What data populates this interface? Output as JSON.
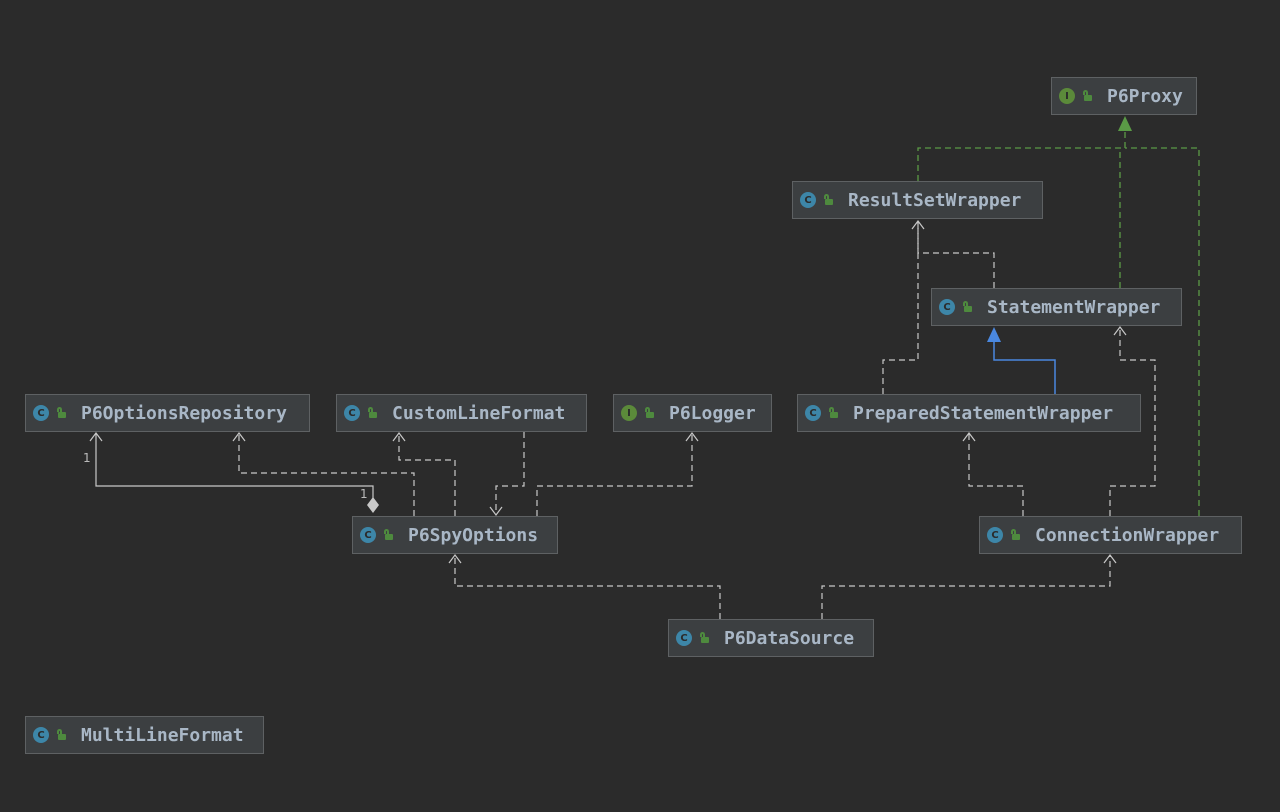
{
  "nodes": [
    {
      "id": "p6proxy",
      "label": "P6Proxy",
      "kind": "interface",
      "badge": "I"
    },
    {
      "id": "resultsetwrapper",
      "label": "ResultSetWrapper",
      "kind": "class",
      "badge": "C"
    },
    {
      "id": "statementwrapper",
      "label": "StatementWrapper",
      "kind": "class",
      "badge": "C"
    },
    {
      "id": "p6optionsrepository",
      "label": "P6OptionsRepository",
      "kind": "class",
      "badge": "C"
    },
    {
      "id": "customlineformat",
      "label": "CustomLineFormat",
      "kind": "class",
      "badge": "C"
    },
    {
      "id": "p6logger",
      "label": "P6Logger",
      "kind": "interface",
      "badge": "I"
    },
    {
      "id": "preparedstatementwrapper",
      "label": "PreparedStatementWrapper",
      "kind": "class",
      "badge": "C"
    },
    {
      "id": "p6spyoptions",
      "label": "P6SpyOptions",
      "kind": "class",
      "badge": "C"
    },
    {
      "id": "connectionwrapper",
      "label": "ConnectionWrapper",
      "kind": "class",
      "badge": "C"
    },
    {
      "id": "p6datasource",
      "label": "P6DataSource",
      "kind": "class",
      "badge": "C"
    },
    {
      "id": "multilineformat",
      "label": "MultiLineFormat",
      "kind": "class",
      "badge": "C"
    }
  ],
  "edges": [
    {
      "from": "resultsetwrapper",
      "to": "p6proxy",
      "type": "implements"
    },
    {
      "from": "statementwrapper",
      "to": "p6proxy",
      "type": "implements"
    },
    {
      "from": "connectionwrapper",
      "to": "p6proxy",
      "type": "implements"
    },
    {
      "from": "statementwrapper",
      "to": "resultsetwrapper",
      "type": "dependency"
    },
    {
      "from": "preparedstatementwrapper",
      "to": "resultsetwrapper",
      "type": "dependency"
    },
    {
      "from": "preparedstatementwrapper",
      "to": "statementwrapper",
      "type": "extends"
    },
    {
      "from": "connectionwrapper",
      "to": "preparedstatementwrapper",
      "type": "dependency"
    },
    {
      "from": "connectionwrapper",
      "to": "statementwrapper",
      "type": "dependency"
    },
    {
      "from": "p6spyoptions",
      "to": "p6optionsrepository",
      "type": "composition"
    },
    {
      "from": "p6spyoptions",
      "to": "p6optionsrepository",
      "type": "dependency"
    },
    {
      "from": "p6spyoptions",
      "to": "customlineformat",
      "type": "dependency"
    },
    {
      "from": "customlineformat",
      "to": "p6spyoptions",
      "type": "dependency"
    },
    {
      "from": "p6spyoptions",
      "to": "p6logger",
      "type": "dependency"
    },
    {
      "from": "p6datasource",
      "to": "p6spyoptions",
      "type": "dependency"
    },
    {
      "from": "p6datasource",
      "to": "connectionwrapper",
      "type": "dependency"
    }
  ],
  "multiplicities": {
    "repository_end": "1",
    "options_end": "1"
  },
  "colors": {
    "background": "#2b2b2b",
    "node_fill": "#3c3f41",
    "node_border": "#5e6163",
    "label": "#a9b7c6",
    "dependency": "#c8c8c8",
    "implements": "#5a9a46",
    "extends": "#4a88e0",
    "composition": "#c8c8c8"
  }
}
